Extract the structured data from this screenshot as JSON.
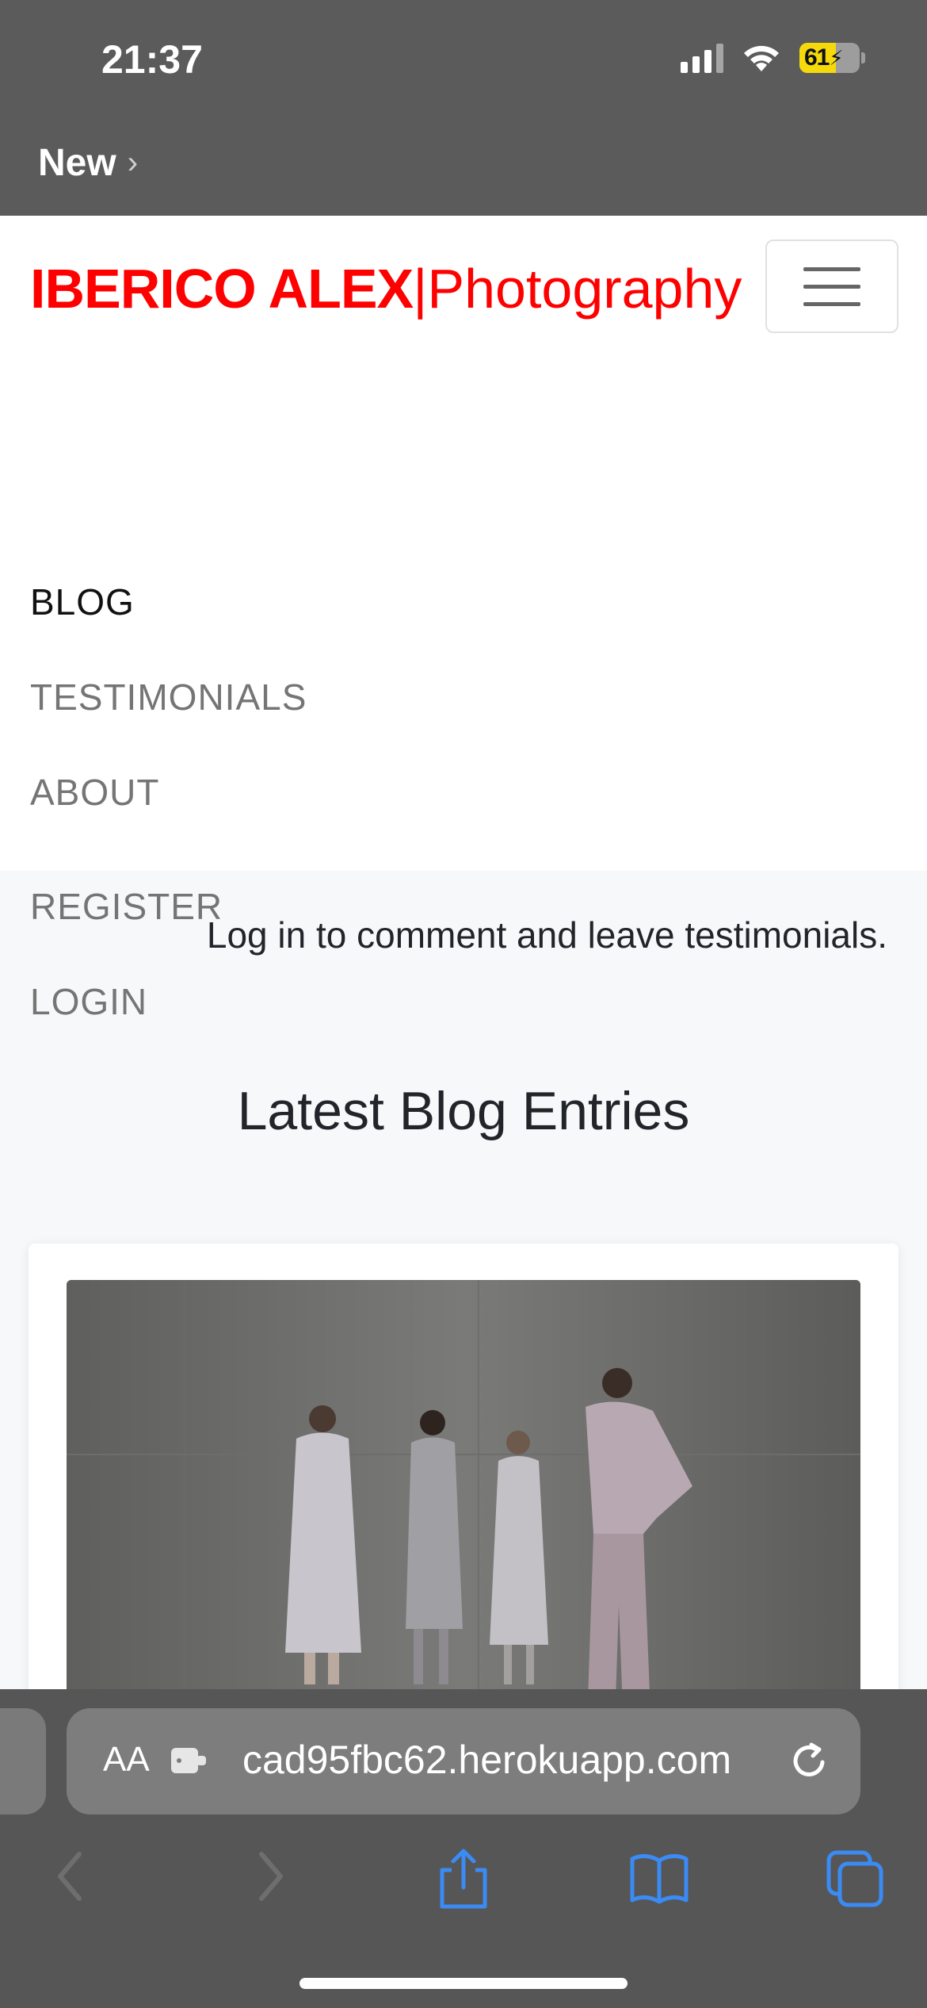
{
  "status": {
    "time": "21:37",
    "battery": "61"
  },
  "back": {
    "label": "New"
  },
  "site": {
    "brand_main": "IBERICO ALEX",
    "brand_sep": "|",
    "brand_sub": "Photography",
    "nav": [
      {
        "label": "BLOG",
        "active": true
      },
      {
        "label": "TESTIMONIALS"
      },
      {
        "label": "ABOUT"
      },
      {
        "label": "REGISTER"
      },
      {
        "label": "LOGIN"
      }
    ],
    "login_note": "Log in to comment and leave testimonials.",
    "section_title": "Latest Blog Entries"
  },
  "browser": {
    "text_size": "AA",
    "url": "cad95fbc62.herokuapp.com"
  },
  "colors": {
    "brand": "#ff0000",
    "chrome": "#565656",
    "accent": "#3b8bf5"
  }
}
